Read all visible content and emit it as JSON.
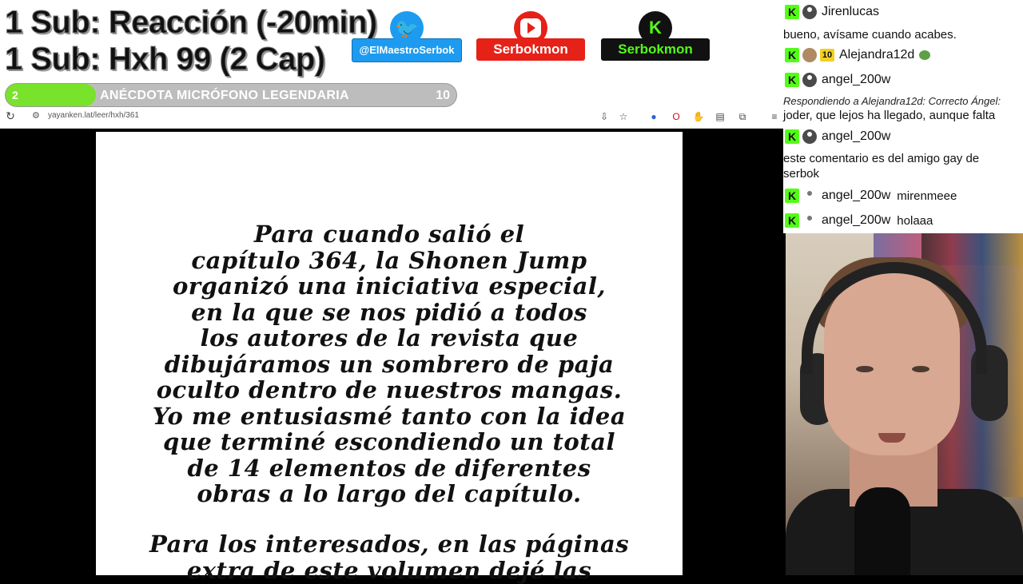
{
  "overlay": {
    "sub_line_1": "1 Sub: Reacción (-20min)",
    "sub_line_2": "1 Sub: Hxh 99 (2 Cap)",
    "goal": {
      "current": "2",
      "target": "10",
      "label": "ANÉCDOTA MICRÓFONO LEGENDARIA",
      "progress_fraction": 0.2
    },
    "socials": [
      {
        "platform": "twitter",
        "icon": "twitter-bird-icon",
        "handle": "@ElMaestroSerbok",
        "color": "#1d9bf0"
      },
      {
        "platform": "youtube",
        "icon": "youtube-play-icon",
        "handle": "Serbokmon",
        "color": "#e62117"
      },
      {
        "platform": "kick",
        "icon": "kick-k-icon",
        "handle": "Serbokmon",
        "color": "#53fc18"
      }
    ]
  },
  "browser": {
    "url": "yayanken.lat/leer/hxh/361",
    "toolbar_icons": [
      "install-icon",
      "bookmark-star-icon",
      "extension-blue-icon",
      "opera-icon",
      "hand-icon",
      "reader-icon",
      "puzzle-icon",
      "media-icon"
    ]
  },
  "manga": {
    "paragraph_1": [
      "Para cuando salió el",
      "capítulo 364, la Shonen Jump",
      "organizó una iniciativa especial,",
      "en la que se nos pidió a todos",
      "los autores de la revista que",
      "dibujáramos un sombrero de paja",
      "oculto dentro de nuestros mangas.",
      "Yo me entusiasmé tanto con la idea",
      "que terminé escondiendo un total",
      "de 14 elementos de diferentes",
      "obras a lo largo del capítulo."
    ],
    "paragraph_2": [
      "Para los interesados, en las páginas",
      "extra de este volumen dejé las"
    ]
  },
  "chat": {
    "badge_letter": "K",
    "messages": [
      {
        "user": "Jirenlucas",
        "text": "bueno, avísame cuando acabes."
      },
      {
        "user": "Alejandra12d",
        "level": "10"
      },
      {
        "user": "angel_200w",
        "reply_to": "Respondiendo a Alejandra12d: Correcto Ángel:",
        "text": "joder, que lejos ha llegado, aunque falta"
      },
      {
        "user": "angel_200w",
        "text_line_1": "este comentario es del amigo gay de",
        "text_line_2": "serbok"
      },
      {
        "user": "angel_200w",
        "text": "mirenmeee"
      },
      {
        "user": "angel_200w",
        "text": "holaaa"
      }
    ]
  }
}
